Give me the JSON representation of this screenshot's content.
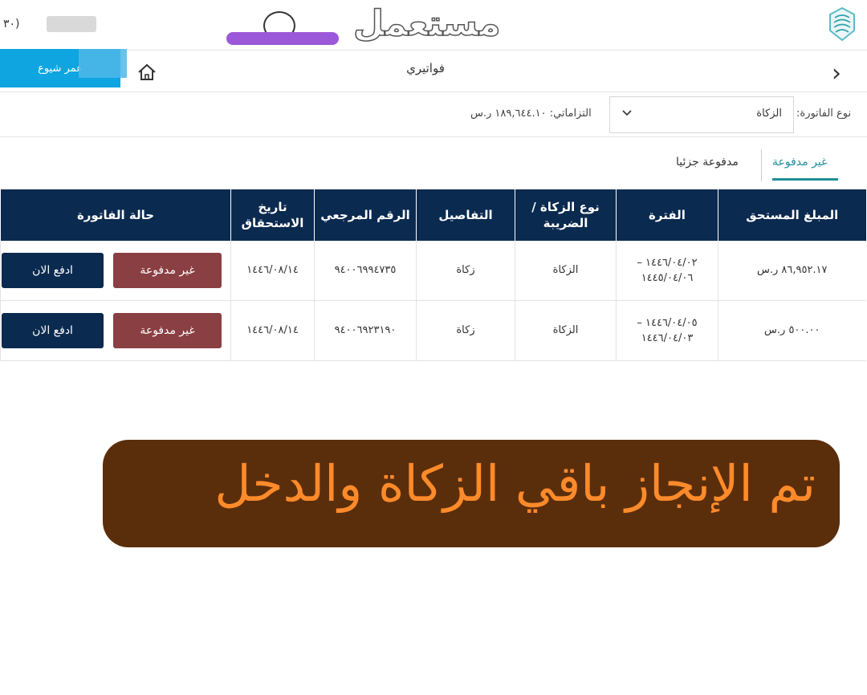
{
  "top": {
    "left_text": "(٣٠",
    "watermark": "مستعمل"
  },
  "nav": {
    "title": "فواتيري",
    "cta_label": "عمر شيوع"
  },
  "filters": {
    "type_label": "نوع الفاتورة:",
    "type_value": "الزكاة",
    "obligation_label": "التزاماتي:",
    "obligation_value": "١٨٩,٦٤٤.١٠ ر.س"
  },
  "tabs": {
    "unpaid": "غير مدفوعة",
    "partial": "مدفوعة جزئيا"
  },
  "table": {
    "headers": {
      "amount": "المبلغ المستحق",
      "period": "الفترة",
      "type": "نوع الزكاة / الضريبة",
      "details": "التفاصيل",
      "reference": "الرقم المرجعي",
      "due": "تاريخ الاستحقاق",
      "status": "حالة الفاتورة"
    },
    "rows": [
      {
        "amount": "٨٦,٩٥٢.١٧ ر.س",
        "period_1": "١٤٤٦/٠٤/٠٢ –",
        "period_2": "١٤٤٥/٠٤/٠٦",
        "type": "الزكاة",
        "details": "زكاة",
        "reference": "٩٤٠٠٦٩٩٤٧٣٥",
        "due": "١٤٤٦/٠٨/١٤",
        "status": "غير مدفوعة",
        "pay": "ادفع الان"
      },
      {
        "amount": "٥٠٠.٠٠ ر.س",
        "period_1": "١٤٤٦/٠٤/٠٥ –",
        "period_2": "١٤٤٦/٠٤/٠٣",
        "type": "الزكاة",
        "details": "زكاة",
        "reference": "٩٤٠٠٦٩٢٣١٩٠",
        "due": "١٤٤٦/٠٨/١٤",
        "status": "غير مدفوعة",
        "pay": "ادفع الان"
      }
    ]
  },
  "banner": {
    "text": "تم الإنجاز باقي الزكاة والدخل"
  },
  "colors": {
    "header_bg": "#0b2a4f",
    "status_bg": "#8a3f42",
    "accent": "#1f8f9a",
    "banner_bg": "#5b2e0b",
    "banner_text": "#ff8a2a",
    "cta": "#0ea5e0"
  }
}
